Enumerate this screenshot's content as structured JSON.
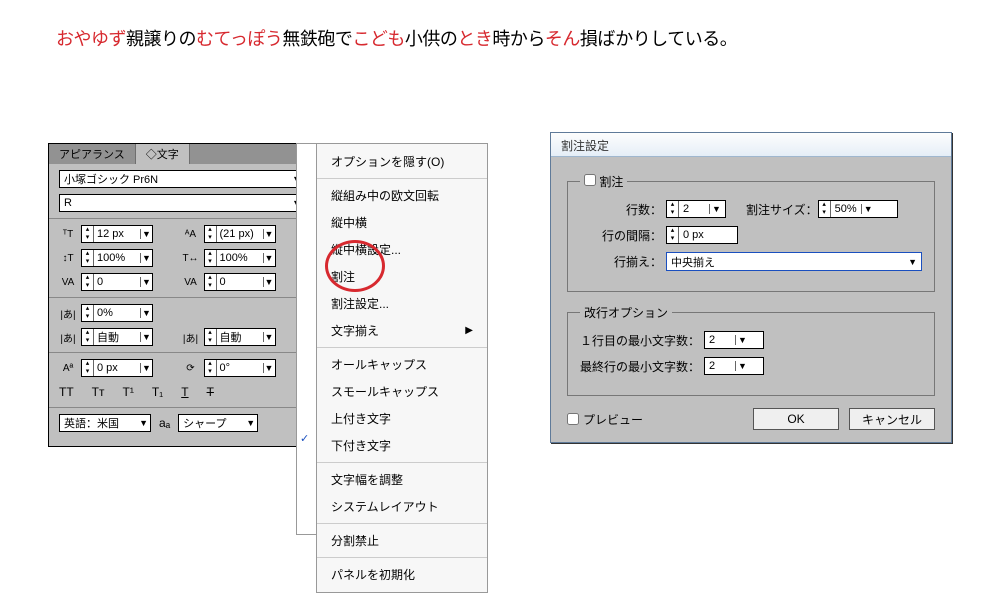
{
  "headline": {
    "seg1_red": "おやゆず",
    "seg1_blk": "親譲りの",
    "seg2_red": "むてっぽう",
    "seg2_blk": "無鉄砲で",
    "seg3_red": "こども",
    "seg3_blk": "小供の",
    "seg4_red": "とき",
    "seg4_blk": "時から",
    "seg5_red": "そん",
    "seg5_blk": "損ばかりしている。"
  },
  "panel": {
    "tabs": {
      "appearance": "アピアランス",
      "character": "◇文字"
    },
    "font": "小塚ゴシック Pr6N",
    "weight": "R",
    "size": "12 px",
    "leading": "(21 px)",
    "vscale": "100%",
    "hscale": "100%",
    "kerning": "0",
    "tracking": "0",
    "akigap1": "0%",
    "akigap2": "自動",
    "akigap3": "自動",
    "baseline": "0 px",
    "rotation": "0°",
    "lang": "英語：米国",
    "aa_label": "aₐ",
    "aa": "シャープ"
  },
  "menu": {
    "hide": "オプションを隠す(O)",
    "tatechuyoko_rot": "縦組み中の欧文回転",
    "tatechuyoko": "縦中横",
    "tatechuyoko_set": "縦中横設定...",
    "warichu": "割注",
    "warichu_set": "割注設定...",
    "charalign": "文字揃え",
    "allcaps": "オールキャップス",
    "smallcaps": "スモールキャップス",
    "sup": "上付き文字",
    "sub": "下付き文字",
    "proportional": "文字幅を調整",
    "syslayout": "システムレイアウト",
    "nobreak": "分割禁止",
    "reset": "パネルを初期化"
  },
  "dialog": {
    "title": "割注設定",
    "fs_warichu": "割注",
    "lines_lbl": "行数：",
    "lines_val": "2",
    "size_lbl": "割注サイズ：",
    "size_val": "50%",
    "gap_lbl": "行の間隔：",
    "gap_val": "0 px",
    "align_lbl": "行揃え：",
    "align_val": "中央揃え",
    "fs_break": "改行オプション",
    "firstmin_lbl": "１行目の最小文字数：",
    "firstmin_val": "2",
    "lastmin_lbl": "最終行の最小文字数：",
    "lastmin_val": "2",
    "preview": "プレビュー",
    "ok": "OK",
    "cancel": "キャンセル"
  }
}
